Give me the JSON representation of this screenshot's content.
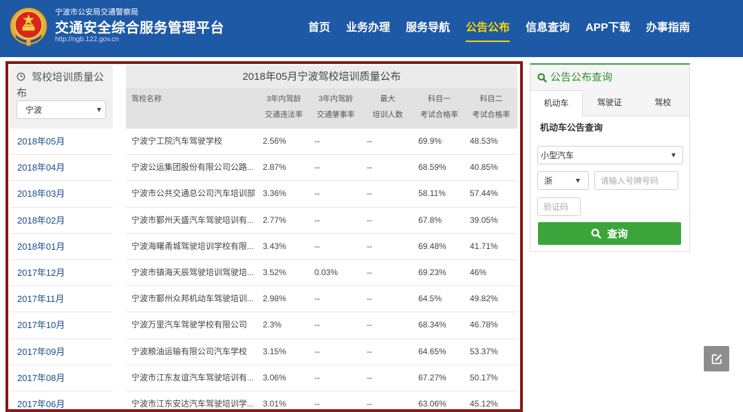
{
  "colors": {
    "header_bg": "#1e59a6",
    "nav_active": "#ffd800",
    "box_border": "#8b1414",
    "month_link": "#1a4b8c",
    "panel_accent": "#3c9c3c",
    "query_button": "#3ba53b"
  },
  "header": {
    "logo_icon": "police-emblem-icon",
    "org_name": "宁波市公安局交通警察局",
    "platform_name": "交通安全综合服务管理平台",
    "url": "http://ngb.122.gov.cn",
    "nav": [
      {
        "label": "首页",
        "active": false
      },
      {
        "label": "业务办理",
        "active": false
      },
      {
        "label": "服务导航",
        "active": false
      },
      {
        "label": "公告公布",
        "active": true
      },
      {
        "label": "信息查询",
        "active": false
      },
      {
        "label": "APP下载",
        "active": false
      },
      {
        "label": "办事指南",
        "active": false
      }
    ]
  },
  "sidebar": {
    "title_icon": "clock-icon",
    "title": "驾校培训质量公布",
    "region": "宁波",
    "months": [
      "2018年05月",
      "2018年04月",
      "2018年03月",
      "2018年02月",
      "2018年01月",
      "2017年12月",
      "2017年11月",
      "2017年10月",
      "2017年09月",
      "2017年08月",
      "2017年06月"
    ]
  },
  "table": {
    "title": "2018年05月宁波驾校培训质量公布",
    "columns": [
      [
        "驾校名称"
      ],
      [
        "3年内驾龄",
        "交通违法率"
      ],
      [
        "3年内驾龄",
        "交通肇事率"
      ],
      [
        "最大",
        "培训人数"
      ],
      [
        "科目一",
        "考试合格率"
      ],
      [
        "科目二",
        "考试合格率"
      ]
    ],
    "rows": [
      [
        "宁波宁工院汽车驾驶学校",
        "2.56%",
        "--",
        "--",
        "69.9%",
        "48.53%"
      ],
      [
        "宁波公运集团股份有限公司公路...",
        "2.87%",
        "--",
        "--",
        "68.59%",
        "40.85%"
      ],
      [
        "宁波市公共交通总公司汽车培训部",
        "3.36%",
        "--",
        "--",
        "58.11%",
        "57.44%"
      ],
      [
        "宁波市鄞州天盛汽车驾驶培训有...",
        "2.77%",
        "--",
        "--",
        "67.8%",
        "39.05%"
      ],
      [
        "宁波海曙甬城驾驶培训学校有限...",
        "3.43%",
        "--",
        "--",
        "69.48%",
        "41.71%"
      ],
      [
        "宁波市镇海天辰驾驶培训驾驶培...",
        "3.52%",
        "0.03%",
        "--",
        "69.23%",
        "46%"
      ],
      [
        "宁波市鄞州众邦机动车驾驶培训...",
        "2.98%",
        "--",
        "--",
        "64.5%",
        "49.82%"
      ],
      [
        "宁波万里汽车驾驶学校有限公司",
        "2.3%",
        "--",
        "--",
        "68.34%",
        "46.78%"
      ],
      [
        "宁波粮油运输有限公司汽车学校",
        "3.15%",
        "--",
        "--",
        "64.65%",
        "53.37%"
      ],
      [
        "宁波市江东友谊汽车驾驶培训有...",
        "3.06%",
        "--",
        "--",
        "67.27%",
        "50.17%"
      ],
      [
        "宁波市江东安达汽车驾驶培训学...",
        "3.01%",
        "--",
        "--",
        "63.06%",
        "45.12%"
      ]
    ]
  },
  "query_panel": {
    "title_icon": "search-icon",
    "title": "公告公布查询",
    "tabs": [
      {
        "label": "机动车",
        "active": true
      },
      {
        "label": "驾驶证",
        "active": false
      },
      {
        "label": "驾校",
        "active": false
      }
    ],
    "section_title": "机动车公告查询",
    "vehicle_type": "小型汽车",
    "province": "浙",
    "plate_placeholder": "请输入号牌号码",
    "captcha_placeholder": "验证码",
    "submit_icon": "search-icon",
    "submit_label": "查询"
  },
  "float_button": {
    "icon": "edit-icon"
  }
}
